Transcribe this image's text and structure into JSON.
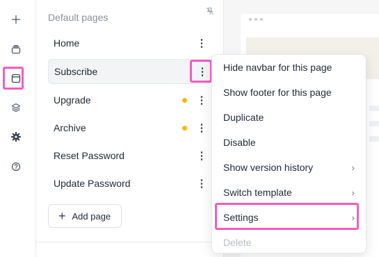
{
  "sidebar": {
    "icons": [
      "plus-icon",
      "stack-icon",
      "browser-window-icon",
      "layers-icon",
      "gear-icon",
      "help-icon"
    ],
    "active": "browser-window-icon"
  },
  "pages_panel": {
    "title": "Default pages",
    "pages": [
      {
        "label": "Home",
        "dot": false
      },
      {
        "label": "Subscribe",
        "dot": false,
        "active": true
      },
      {
        "label": "Upgrade",
        "dot": true
      },
      {
        "label": "Archive",
        "dot": true
      },
      {
        "label": "Reset Password",
        "dot": false
      },
      {
        "label": "Update Password",
        "dot": false
      }
    ],
    "add_label": "Add page",
    "kebab_glyph": "⋮"
  },
  "context_menu": {
    "items": [
      {
        "label": "Hide navbar for this page",
        "submenu": false,
        "disabled": false
      },
      {
        "label": "Show footer for this page",
        "submenu": false,
        "disabled": false
      },
      {
        "label": "Duplicate",
        "submenu": false,
        "disabled": false
      },
      {
        "label": "Disable",
        "submenu": false,
        "disabled": false
      },
      {
        "label": "Show version history",
        "submenu": true,
        "disabled": false
      },
      {
        "label": "Switch template",
        "submenu": true,
        "disabled": false
      },
      {
        "label": "Settings",
        "submenu": true,
        "disabled": false,
        "highlighted": true
      },
      {
        "label": "Delete",
        "submenu": false,
        "disabled": true
      }
    ],
    "chevron_glyph": "›"
  },
  "colors": {
    "highlight": "#f25cc0",
    "status_dot": "#f5b800",
    "disabled_text": "#b8bcc4"
  }
}
